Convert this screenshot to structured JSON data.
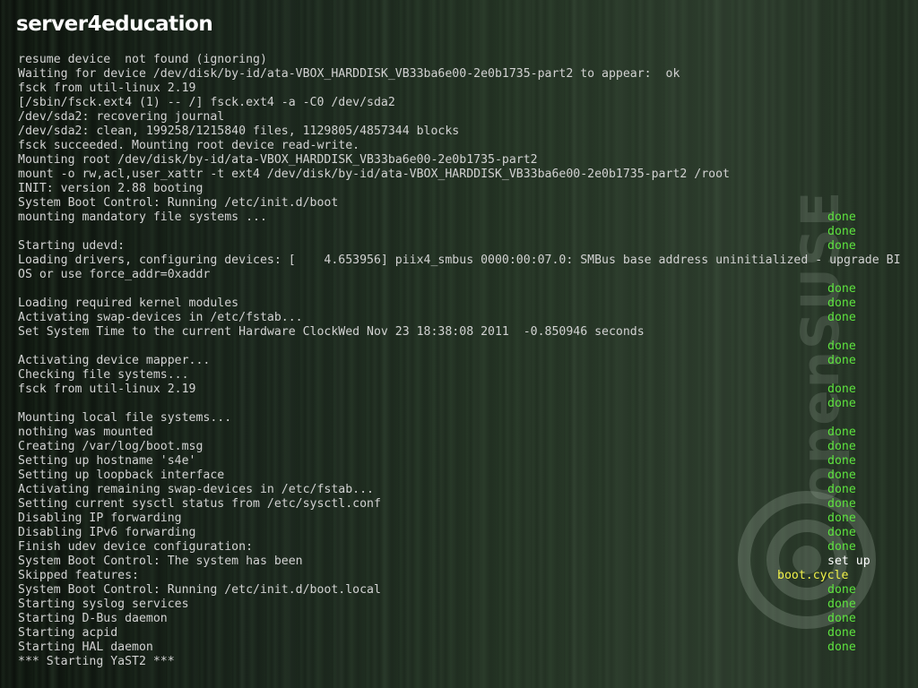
{
  "brand": {
    "title": "server4education"
  },
  "colors": {
    "done": "#5ee33f",
    "setup": "#ffffff",
    "boot": "#f0f048",
    "text": "#d2d2d2"
  },
  "console": {
    "lines": [
      {
        "text": "resume device  not found (ignoring)",
        "status": ""
      },
      {
        "text": "Waiting for device /dev/disk/by-id/ata-VBOX_HARDDISK_VB33ba6e00-2e0b1735-part2 to appear:  ok",
        "status": ""
      },
      {
        "text": "fsck from util-linux 2.19",
        "status": ""
      },
      {
        "text": "[/sbin/fsck.ext4 (1) -- /] fsck.ext4 -a -C0 /dev/sda2",
        "status": ""
      },
      {
        "text": "/dev/sda2: recovering journal",
        "status": ""
      },
      {
        "text": "/dev/sda2: clean, 199258/1215840 files, 1129805/4857344 blocks",
        "status": ""
      },
      {
        "text": "fsck succeeded. Mounting root device read-write.",
        "status": ""
      },
      {
        "text": "Mounting root /dev/disk/by-id/ata-VBOX_HARDDISK_VB33ba6e00-2e0b1735-part2",
        "status": ""
      },
      {
        "text": "mount -o rw,acl,user_xattr -t ext4 /dev/disk/by-id/ata-VBOX_HARDDISK_VB33ba6e00-2e0b1735-part2 /root",
        "status": ""
      },
      {
        "text": "INIT: version 2.88 booting",
        "status": ""
      },
      {
        "text": "System Boot Control: Running /etc/init.d/boot",
        "status": ""
      },
      {
        "text": "mounting mandatory file systems ...",
        "status": "done"
      },
      {
        "text": "",
        "status": "done"
      },
      {
        "text": "Starting udevd:",
        "status": "done"
      },
      {
        "text": "Loading drivers, configuring devices: [    4.653956] piix4_smbus 0000:00:07.0: SMBus base address uninitialized - upgrade BI",
        "status": ""
      },
      {
        "text": "OS or use force_addr=0xaddr",
        "status": ""
      },
      {
        "text": "",
        "status": "done"
      },
      {
        "text": "Loading required kernel modules",
        "status": "done"
      },
      {
        "text": "Activating swap-devices in /etc/fstab...",
        "status": "done"
      },
      {
        "text": "Set System Time to the current Hardware ClockWed Nov 23 18:38:08 2011  -0.850946 seconds",
        "status": ""
      },
      {
        "text": "",
        "status": "done"
      },
      {
        "text": "Activating device mapper...",
        "status": "done"
      },
      {
        "text": "Checking file systems...",
        "status": ""
      },
      {
        "text": "fsck from util-linux 2.19",
        "status": "done"
      },
      {
        "text": "",
        "status": "done"
      },
      {
        "text": "Mounting local file systems...",
        "status": ""
      },
      {
        "text": "nothing was mounted",
        "status": "done"
      },
      {
        "text": "Creating /var/log/boot.msg",
        "status": "done"
      },
      {
        "text": "Setting up hostname 's4e'",
        "status": "done"
      },
      {
        "text": "Setting up loopback interface",
        "status": "done"
      },
      {
        "text": "Activating remaining swap-devices in /etc/fstab...",
        "status": "done"
      },
      {
        "text": "Setting current sysctl status from /etc/sysctl.conf",
        "status": "done"
      },
      {
        "text": "Disabling IP forwarding",
        "status": "done"
      },
      {
        "text": "Disabling IPv6 forwarding",
        "status": "done"
      },
      {
        "text": "Finish udev device configuration:",
        "status": "done"
      },
      {
        "text": "System Boot Control: The system has been",
        "status": "set up"
      },
      {
        "text": "Skipped features:",
        "status": "boot.cycle"
      },
      {
        "text": "System Boot Control: Running /etc/init.d/boot.local",
        "status": "done"
      },
      {
        "text": "Starting syslog services",
        "status": "done"
      },
      {
        "text": "Starting D-Bus daemon",
        "status": "done"
      },
      {
        "text": "Starting acpid",
        "status": "done"
      },
      {
        "text": "Starting HAL daemon",
        "status": "done"
      },
      {
        "text": "*** Starting YaST2 ***",
        "status": ""
      }
    ]
  },
  "icons": {
    "watermark": "opensuse-logo-watermark-icon"
  }
}
